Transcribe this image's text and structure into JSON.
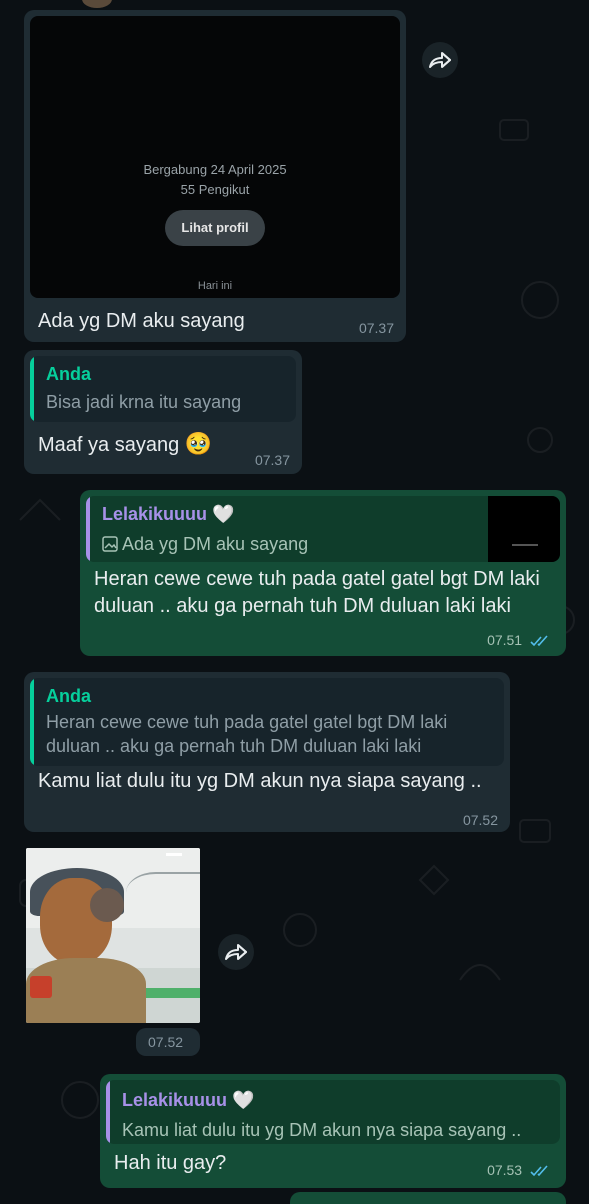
{
  "profile_card": {
    "joined": "Bergabung 24 April 2025",
    "followers": "55 Pengikut",
    "view_profile": "Lihat profil",
    "day": "Hari ini"
  },
  "messages": [
    {
      "text": "Ada yg DM aku sayang",
      "time": "07.37"
    },
    {
      "quote_name": "Anda",
      "quote_text": "Bisa jadi krna itu sayang",
      "text": "Maaf ya sayang",
      "emoji": "🥹",
      "time": "07.37"
    },
    {
      "quote_name": "Lelakikuuuu",
      "quote_heart": "🤍",
      "quote_text": "Ada yg DM aku sayang",
      "quote_icon": "image-icon",
      "text": "Heran cewe cewe tuh pada gatel gatel bgt DM laki duluan .. aku ga pernah tuh DM duluan laki laki",
      "time": "07.51"
    },
    {
      "quote_name": "Anda",
      "quote_text": "Heran cewe cewe tuh pada gatel gatel bgt DM laki duluan .. aku ga pernah tuh DM duluan laki laki",
      "text": "Kamu liat dulu itu yg DM akun nya siapa sayang ..",
      "time": "07.52"
    },
    {
      "type": "sticker",
      "time": "07.52"
    },
    {
      "quote_name": "Lelakikuuuu",
      "quote_heart": "🤍",
      "quote_text": "Kamu liat dulu itu yg DM akun nya siapa sayang ..",
      "text": "Hah itu gay?",
      "time": "07.53"
    }
  ],
  "colors": {
    "background": "#0b1014",
    "incoming": "#1f2c33",
    "outgoing": "#144d37",
    "quote_anda": "#06cf9c",
    "quote_lelaki": "#a791e8",
    "read_ticks": "#53bdeb"
  },
  "icons": [
    "forward-icon",
    "image-icon",
    "read-ticks-icon"
  ]
}
